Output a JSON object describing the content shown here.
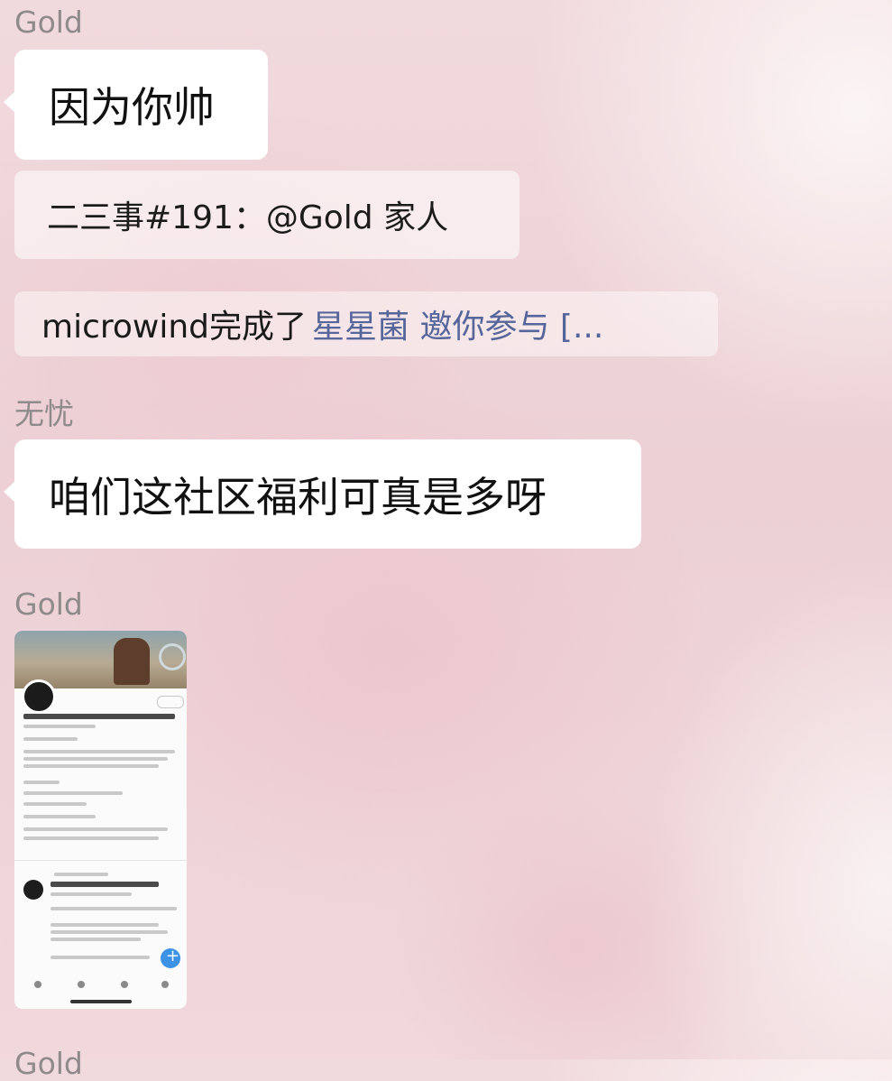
{
  "messages": [
    {
      "sender": "Gold",
      "text": "因为你帅"
    },
    {
      "quote": "二三事#191：@Gold 家人"
    },
    {
      "notice": {
        "actor": "microwind完成了",
        "link": "星星菌 邀你参与 [..."
      }
    },
    {
      "sender": "无忧",
      "text": "咱们这社区福利可真是多呀"
    },
    {
      "sender": "Gold",
      "image": "shared-profile-screenshot"
    },
    {
      "sender": "Gold"
    }
  ],
  "colors": {
    "sender": "#8f8a8b",
    "bubble": "#ffffff",
    "link": "#56669a"
  }
}
